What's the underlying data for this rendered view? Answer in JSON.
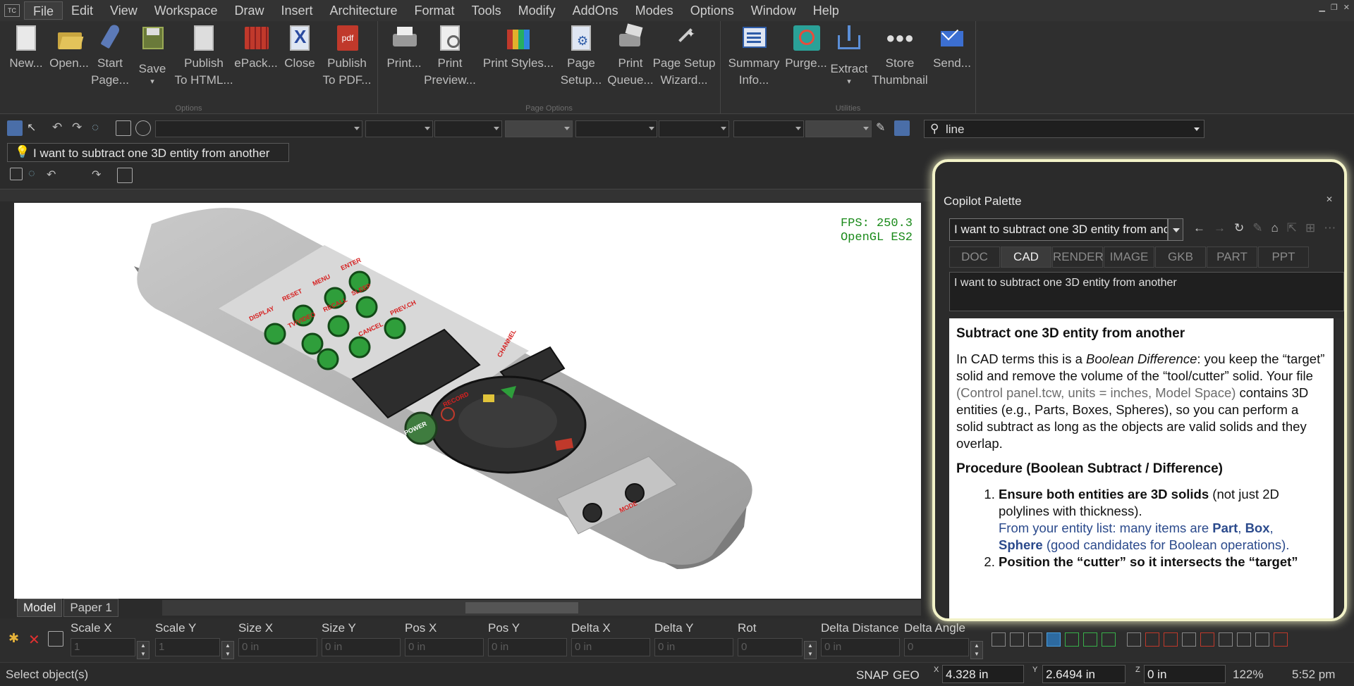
{
  "menu": [
    "File",
    "Edit",
    "View",
    "Workspace",
    "Draw",
    "Insert",
    "Architecture",
    "Format",
    "Tools",
    "Modify",
    "AddOns",
    "Modes",
    "Options",
    "Window",
    "Help"
  ],
  "ribbon": {
    "options_buttons": [
      {
        "icon": "new-document-icon",
        "line1": "New...",
        "line2": ""
      },
      {
        "icon": "open-folder-icon",
        "line1": "Open...",
        "line2": ""
      },
      {
        "icon": "rocket-icon",
        "line1": "Start",
        "line2": "Page..."
      },
      {
        "icon": "floppy-disk-icon",
        "line1": "Save",
        "line2": "▾"
      },
      {
        "icon": "publish-html-icon",
        "line1": "Publish",
        "line2": "To HTML..."
      },
      {
        "icon": "epack-icon",
        "line1": "ePack...",
        "line2": ""
      },
      {
        "icon": "close-document-icon",
        "line1": "Close",
        "line2": ""
      },
      {
        "icon": "pdf-icon",
        "line1": "Publish",
        "line2": "To PDF..."
      }
    ],
    "page_buttons": [
      {
        "icon": "printer-icon",
        "line1": "Print...",
        "line2": ""
      },
      {
        "icon": "print-preview-icon",
        "line1": "Print",
        "line2": "Preview..."
      },
      {
        "icon": "print-styles-icon",
        "line1": "Print Styles...",
        "line2": ""
      },
      {
        "icon": "page-setup-icon",
        "line1": "Page",
        "line2": "Setup..."
      },
      {
        "icon": "print-queue-icon",
        "line1": "Print",
        "line2": "Queue..."
      },
      {
        "icon": "page-setup-wizard-icon",
        "line1": "Page Setup",
        "line2": "Wizard..."
      }
    ],
    "util_buttons": [
      {
        "icon": "summary-info-icon",
        "line1": "Summary",
        "line2": "Info..."
      },
      {
        "icon": "purge-icon",
        "line1": "Purge...",
        "line2": ""
      },
      {
        "icon": "extract-icon",
        "line1": "Extract",
        "line2": "▾"
      },
      {
        "icon": "store-thumbnail-icon",
        "line1": "Store",
        "line2": "Thumbnail"
      },
      {
        "icon": "send-mail-icon",
        "line1": "Send...",
        "line2": ""
      }
    ],
    "group_options": "Options",
    "group_page": "Page Options",
    "group_util": "Utilities",
    "pdf_badge": "pdf"
  },
  "search": {
    "value": "line"
  },
  "hint": {
    "text": "I want to subtract one 3D entity from another"
  },
  "viewport": {
    "fps": "FPS: 250.3",
    "renderer": "OpenGL ES2"
  },
  "tabs": [
    "Model",
    "Paper 1"
  ],
  "propbar": [
    {
      "label": "Scale X",
      "value": "1",
      "spin": true
    },
    {
      "label": "Scale Y",
      "value": "1",
      "spin": true
    },
    {
      "label": "Size X",
      "value": "0 in",
      "spin": false
    },
    {
      "label": "Size Y",
      "value": "0 in",
      "spin": false
    },
    {
      "label": "Pos X",
      "value": "0 in",
      "spin": false
    },
    {
      "label": "Pos Y",
      "value": "0 in",
      "spin": false
    },
    {
      "label": "Delta X",
      "value": "0 in",
      "spin": false
    },
    {
      "label": "Delta Y",
      "value": "0 in",
      "spin": false
    },
    {
      "label": "Rot",
      "value": "0",
      "spin": true
    },
    {
      "label": "Delta Distance",
      "value": "0 in",
      "spin": false
    },
    {
      "label": "Delta Angle",
      "value": "0",
      "spin": true
    }
  ],
  "status": {
    "prompt": "Select object(s)",
    "snap": "SNAP",
    "geo": "GEO",
    "x": "4.328 in",
    "y": "2.6494 in",
    "z": "0 in",
    "x_label": "X",
    "y_label": "Y",
    "z_label": "Z",
    "zoom": "122%",
    "time": "5:52 pm"
  },
  "copilot": {
    "title": "Copilot Palette",
    "query": "I want to subtract one 3D entity from another",
    "tabs": [
      "DOC",
      "CAD",
      "RENDER",
      "IMAGE",
      "GKB",
      "PART",
      "PPT"
    ],
    "active_tab": "CAD",
    "echo": "I want to subtract one 3D entity from another",
    "heading": "Subtract one 3D entity from another",
    "p1_a": "In CAD terms this is a ",
    "p1_em": "Boolean Difference",
    "p1_b": ": you keep the “target” solid and remove the volume of the “tool/cutter” solid. Your file ",
    "p1_grey": "(Control panel.tcw, units = inches, Model Space)",
    "p1_c": " contains 3D entities (e.g., Parts, Boxes, Spheres), so you can perform a solid subtract as long as the objects are valid solids and they overlap.",
    "heading2": "Procedure (Boolean Subtract / Difference)",
    "step1_bold": "Ensure both entities are 3D solids",
    "step1_rest": " (not just 2D polylines with thickness).",
    "step1_blue_a": "From your entity list: many items are ",
    "step1_part": "Part",
    "step1_sep1": ", ",
    "step1_box": "Box",
    "step1_sep2": ",",
    "step1_sphere": "Sphere",
    "step1_blue_b": " (good candidates for Boolean operations).",
    "step2_bold": "Position the “cutter” so it intersects the “target”"
  },
  "remote_labels": [
    "DISPLAY",
    "RESET",
    "MENU",
    "ENTER",
    "TV/VIDEO",
    "RECALL",
    "SLEEP",
    "PREV.CH",
    "CANCEL",
    "POWER",
    "RECORD",
    "ZOOM",
    "MODE",
    "CHANNEL"
  ]
}
